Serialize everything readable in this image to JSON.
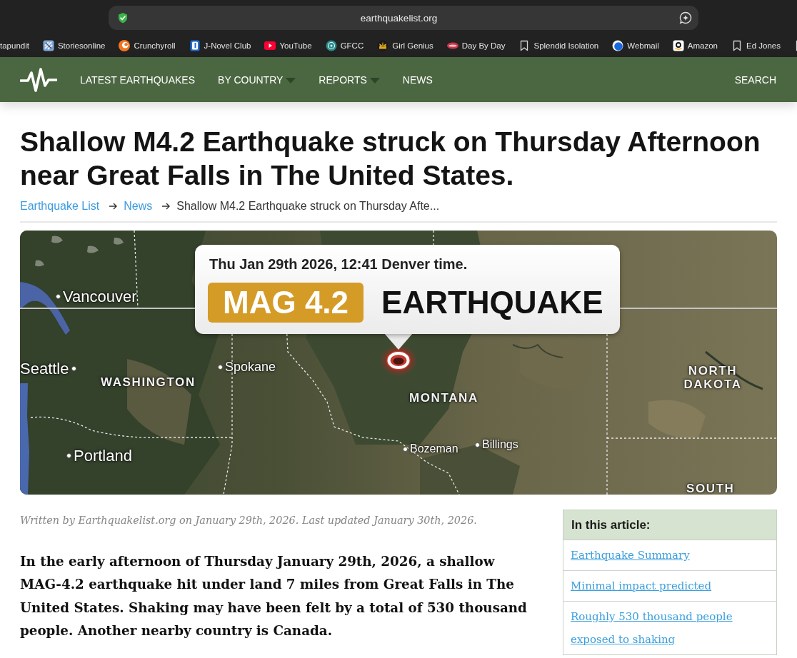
{
  "browser": {
    "address": "earthquakelist.org",
    "bookmarks": [
      "tapundit",
      "Storiesonline",
      "Crunchyroll",
      "J-Novel Club",
      "YouTube",
      "GFCC",
      "Girl Genius",
      "Day By Day",
      "Splendid Isolation",
      "Webmail",
      "Amazon",
      "Ed Jones"
    ]
  },
  "nav": {
    "items": [
      {
        "label": "LATEST EARTHQUAKES",
        "dropdown": false
      },
      {
        "label": "BY COUNTRY",
        "dropdown": true
      },
      {
        "label": "REPORTS",
        "dropdown": true
      },
      {
        "label": "NEWS",
        "dropdown": false
      }
    ],
    "search": "SEARCH"
  },
  "article": {
    "title": "Shallow M4.2 Earthquake struck on Thursday Afternoon near Great Falls in The United States.",
    "breadcrumb": [
      {
        "label": "Earthquake List",
        "link": true
      },
      {
        "label": "News",
        "link": true
      },
      {
        "label": "Shallow M4.2 Earthquake struck on Thursday Afte...",
        "link": false
      }
    ],
    "map": {
      "callout": {
        "time": "Thu Jan 29th 2026, 12:41 Denver time.",
        "magnitude": "MAG 4.2",
        "headline": "EARTHQUAKE"
      },
      "labels": [
        {
          "text": "Vancouver",
          "kind": "city"
        },
        {
          "text": "Seattle",
          "kind": "city"
        },
        {
          "text": "WASHINGTON",
          "kind": "region"
        },
        {
          "text": "Spokane",
          "kind": "city"
        },
        {
          "text": "MONTANA",
          "kind": "region"
        },
        {
          "text": "NORTH DAKOTA",
          "kind": "region"
        },
        {
          "text": "Bozeman",
          "kind": "city"
        },
        {
          "text": "Billings",
          "kind": "city"
        },
        {
          "text": "Portland",
          "kind": "city"
        },
        {
          "text": "SOUTH",
          "kind": "region"
        }
      ]
    },
    "byline": "Written by Earthquakelist.org on January 29th, 2026. Last updated January 30th, 2026.",
    "lead": "In the early afternoon of Thursday January 29th, 2026, a shallow MAG-4.2 earthquake hit under land 7 miles from Great Falls in The United States. Shaking may have been felt by a total of 530 thousand people. Another nearby country is Canada.",
    "toc": {
      "title": "In this article:",
      "items": [
        "Earthquake Summary",
        "Minimal impact predicted",
        "Roughly 530 thousand people exposed to shaking"
      ]
    }
  }
}
